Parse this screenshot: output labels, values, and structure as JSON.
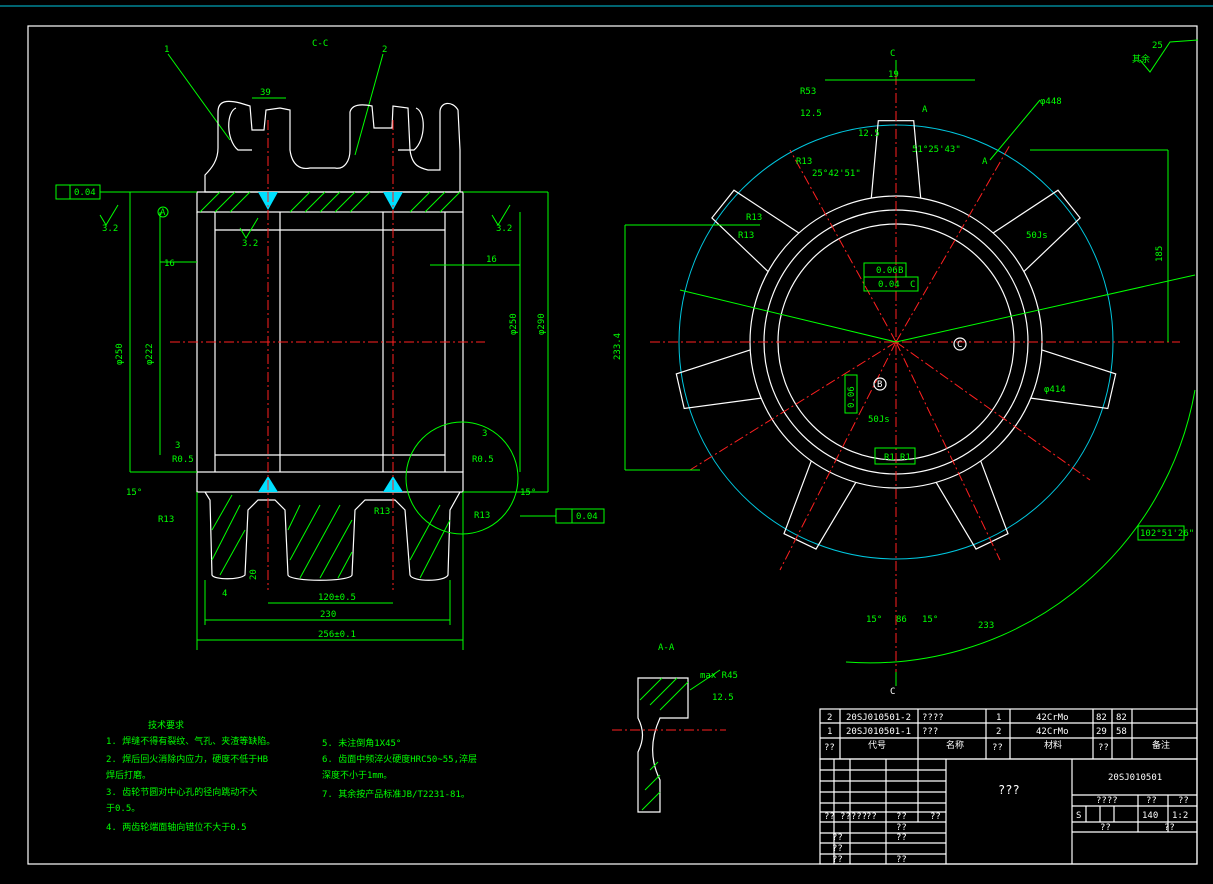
{
  "colors": {
    "background": "#000000",
    "outline": "#ffffff",
    "dimension": "#00ff00",
    "centerline": "#ff2020",
    "pitch_circle": "#00c8e0",
    "weld": "#00e0ff"
  },
  "section_view": {
    "title": "C-C",
    "leaders": [
      "1",
      "2"
    ],
    "dims": {
      "d1": "39",
      "d2": "0.04",
      "d3": "16",
      "d4": "16",
      "d5": "φ250",
      "d6": "φ222",
      "d7": "φ290",
      "d8": "φ250",
      "d9": "120±0.5",
      "d10": "230",
      "d11": "256±0.1",
      "d12": "15°",
      "d13": "15°",
      "d14": "R0.5",
      "d15": "R0.5",
      "d16": "R13",
      "d17": "R13",
      "d18": "R13",
      "d19": "3",
      "d20": "3",
      "d21": "4",
      "d22": "3.2",
      "d23": "3.2",
      "d24": "3.2",
      "d25": "0.04",
      "d26": "A",
      "d27": "20"
    }
  },
  "front_view": {
    "label_top": "C",
    "label_bottom": "C",
    "section_marks": [
      "A",
      "A"
    ],
    "dims": {
      "d1": "19",
      "d2": "R53",
      "d3": "12.5",
      "d4": "12.5",
      "d5": "R13",
      "d6": "25°42'51\"",
      "d7": "51°25'43\"",
      "d8": "φ448",
      "d9": "R13",
      "d10": "R13",
      "d11": "50Js",
      "d12": "185",
      "d13": "233.4",
      "d14": "φ414",
      "d15": "50Js",
      "d16": "R1",
      "d17": "R1",
      "d18": "15°",
      "d19": "86",
      "d20": "15°",
      "d21": "233",
      "d22": "102°51'26\"",
      "d23": "0.06",
      "d24": "0.04",
      "d25": "B",
      "d26": "C",
      "d27": "B",
      "d28": "C"
    },
    "tolerance_frames": [
      "0.06 B",
      "0.04 A C",
      "0.06 B"
    ]
  },
  "roughness_symbol": {
    "value": "25",
    "label": "其余"
  },
  "detail_view": {
    "title": "A-A",
    "radius": "max R45",
    "roughness": "12.5"
  },
  "technical_requirements": {
    "heading": "技术要求",
    "items": [
      "1. 焊缝不得有裂纹、气孔、夹渣等缺陷。",
      "2. 焊后回火消除内应力，硬度不低于HB",
      "   焊后打磨。",
      "3. 齿轮节圆对中心孔的径向跳动不大",
      "   于0.5。",
      "4. 两齿轮端面轴向错位不大于0.5",
      "5. 未注倒角1X45°",
      "6. 齿面中频淬火硬度HRC50~55,淬层",
      "   深度不小于1mm。",
      "7. 其余按产品标准JB/T2231-81。"
    ]
  },
  "parts_list": {
    "rows": [
      {
        "no": "2",
        "code": "20SJ010501-2",
        "name": "????",
        "qty": "1",
        "material": "42CrMo",
        "unit_weight": "82",
        "total_weight": "82",
        "note": ""
      },
      {
        "no": "1",
        "code": "20SJ010501-1",
        "name": "???",
        "qty": "2",
        "material": "42CrMo",
        "unit_weight": "29",
        "total_weight": "58",
        "note": ""
      }
    ],
    "header": {
      "no": "??",
      "code": "代号",
      "name": "名称",
      "qty": "??",
      "material": "材料",
      "weight": "??",
      "note": "备注"
    }
  },
  "title_block": {
    "drawing_no": "20SJ010501",
    "name": "???",
    "material_cell": "????",
    "stage": "S",
    "weight": "140",
    "scale": "1:2",
    "cells": [
      "??",
      "??",
      "??",
      "??",
      "??",
      "?????",
      "??",
      "??",
      "??",
      "??",
      "??",
      "??",
      "??",
      "??",
      "??"
    ]
  }
}
